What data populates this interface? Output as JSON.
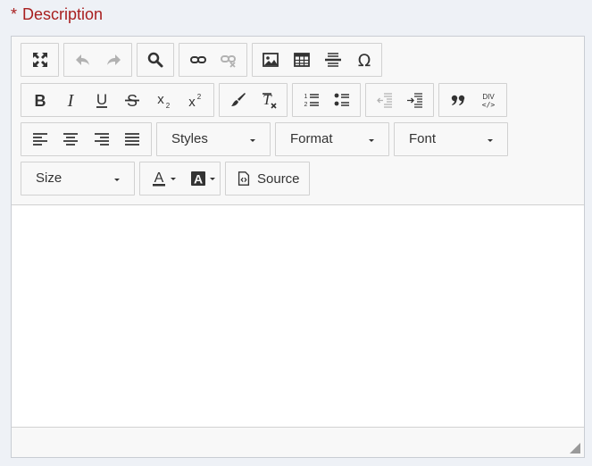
{
  "field": {
    "required_marker": "*",
    "label": "Description"
  },
  "toolbar": {
    "styles_label": "Styles",
    "format_label": "Format",
    "font_label": "Font",
    "size_label": "Size",
    "source_label": "Source"
  },
  "colors": {
    "label": "#a81f1f",
    "border": "#d1d1d1",
    "toolbar_bg": "#f8f8f8"
  }
}
